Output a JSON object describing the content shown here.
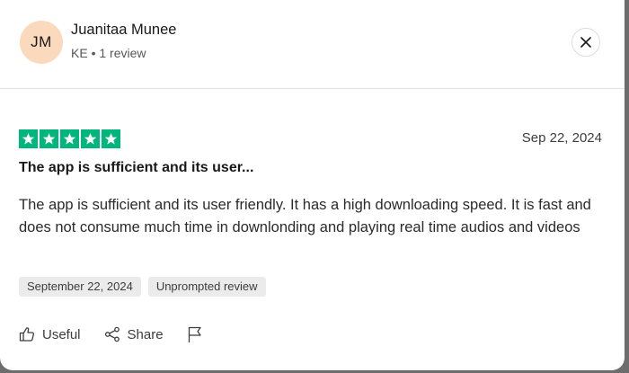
{
  "reviewer": {
    "initials": "JM",
    "name": "Juanitaa Munee",
    "country": "KE",
    "separator": "•",
    "review_count": "1 review"
  },
  "review": {
    "rating": 5,
    "date": "Sep 22, 2024",
    "title": "The app is sufficient and its user...",
    "body": "The app is sufficient and its user friendly. It has a high downloading speed. It is fast and does not consume much time in downlonding and playing real time audios and videos",
    "tags": [
      "September 22, 2024",
      "Unprompted review"
    ]
  },
  "actions": {
    "useful_label": "Useful",
    "share_label": "Share"
  },
  "icons": {
    "close": "close-icon",
    "star": "star-icon",
    "useful": "thumbs-up-icon",
    "share": "share-icon",
    "flag": "flag-icon"
  },
  "colors": {
    "star_green": "#00b67a",
    "avatar_bg": "#fbd9bd",
    "tag_bg": "#ebebeb"
  }
}
